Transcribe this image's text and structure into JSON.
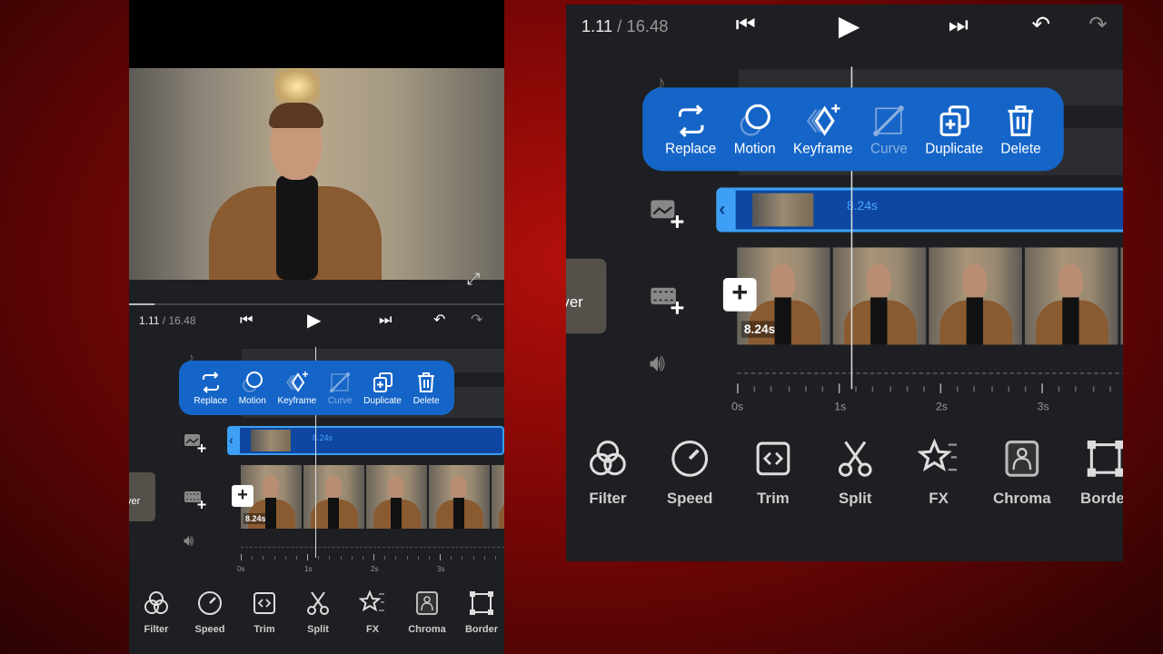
{
  "player": {
    "current_time": "1.11",
    "total_time": " / 16.48"
  },
  "popup": {
    "items": [
      {
        "label": "Replace",
        "icon": "replace-icon"
      },
      {
        "label": "Motion",
        "icon": "motion-icon"
      },
      {
        "label": "Keyframe",
        "icon": "keyframe-icon"
      },
      {
        "label": "Curve",
        "icon": "curve-icon",
        "disabled": true
      },
      {
        "label": "Duplicate",
        "icon": "duplicate-icon"
      },
      {
        "label": "Delete",
        "icon": "trash-icon"
      }
    ]
  },
  "timeline": {
    "overlay_duration": "8.24s",
    "clip_duration": "8.24s",
    "cover_label": "ver",
    "ruler": [
      "0s",
      "1s",
      "2s",
      "3s"
    ]
  },
  "toolbar": {
    "items": [
      {
        "label": "Filter"
      },
      {
        "label": "Speed"
      },
      {
        "label": "Trim"
      },
      {
        "label": "Split"
      },
      {
        "label": "FX"
      },
      {
        "label": "Chroma"
      },
      {
        "label": "Border"
      }
    ]
  },
  "colors": {
    "accent": "#1565c8",
    "background": "#1e1f22",
    "overlay_track": "#0d47a1"
  }
}
